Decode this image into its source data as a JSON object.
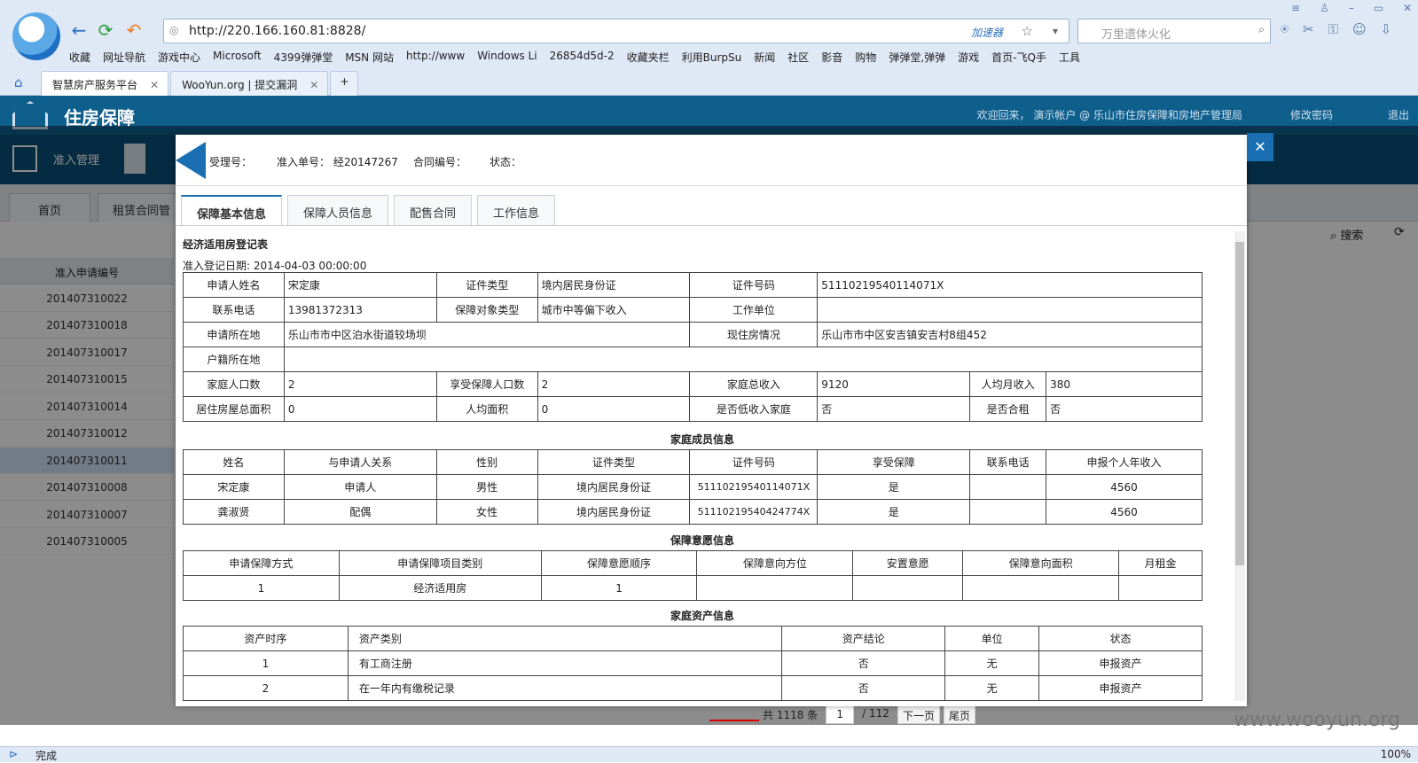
{
  "browser": {
    "url": "http://220.166.160.81:8828/",
    "accelerator": "加速器",
    "search_placeholder": "万里遗体火化",
    "bookmarks": [
      "收藏",
      "网址导航",
      "游戏中心",
      "Microsoft",
      "4399弹弹堂",
      "MSN 网站",
      "http://www",
      "Windows Li",
      "26854d5d-2",
      "收藏夹栏",
      "利用BurpSu",
      "新闻",
      "社区",
      "影音",
      "购物",
      "弹弹堂,弹弹",
      "游戏",
      "首页-飞Q手",
      "工具"
    ],
    "tabs": [
      {
        "label": "智慧房产服务平台"
      },
      {
        "label": "WooYun.org | 提交漏洞"
      }
    ],
    "status": "完成",
    "zoom": "100%"
  },
  "app": {
    "title": "住房保障",
    "welcome": "欢迎回来， 演示帐户 @ 乐山市住房保障和房地产管理局",
    "change_pw": "修改密码",
    "logout": "退出",
    "nav": [
      "准入管理"
    ],
    "subtabs": [
      "首页",
      "租赁合同管"
    ],
    "search": "搜索",
    "list_header": "准入申请编号",
    "list_rows": [
      "201407310022",
      "201407310018",
      "201407310017",
      "201407310015",
      "201407310014",
      "201407310012",
      "201407310011",
      "201407310008",
      "201407310007",
      "201407310005"
    ],
    "pager": {
      "total": "共 1118 条",
      "page": "1",
      "pages": "/ 112",
      "next": "下一页",
      "last": "尾页"
    },
    "watermark": "www.wooyun.org"
  },
  "modal": {
    "f1": "受理号：",
    "f2": "准入单号：  经20147267",
    "f3": "合同编号：",
    "f4": "状态：",
    "tabs": [
      "保障基本信息",
      "保障人员信息",
      "配售合同",
      "工作信息"
    ],
    "form_title": "经济适用房登记表",
    "reg_date_label": "准入登记日期:",
    "reg_date": "2014-04-03 00:00:00",
    "basic": [
      [
        "申请人姓名",
        "宋定康",
        "证件类型",
        "境内居民身份证",
        "证件号码",
        "51110219540114071X"
      ],
      [
        "联系电话",
        "13981372313",
        "保障对象类型",
        "城市中等偏下收入",
        "工作单位",
        ""
      ],
      [
        "申请所在地",
        "乐山市市中区泊水街道较场坝",
        "现住房情况",
        "乐山市市中区安吉镇安吉村8组452"
      ],
      [
        "户籍所在地",
        ""
      ],
      [
        "家庭人口数",
        "2",
        "享受保障人口数",
        "2",
        "家庭总收入",
        "9120",
        "人均月收入",
        "380"
      ],
      [
        "居住房屋总面积",
        "0",
        "人均面积",
        "0",
        "是否低收入家庭",
        "否",
        "是否合租",
        "否"
      ]
    ],
    "family_title": "家庭成员信息",
    "family_head": [
      "姓名",
      "与申请人关系",
      "性别",
      "证件类型",
      "证件号码",
      "享受保障",
      "联系电话",
      "申报个人年收入"
    ],
    "family_rows": [
      [
        "宋定康",
        "申请人",
        "男性",
        "境内居民身份证",
        "51110219540114071X",
        "是",
        "",
        "4560"
      ],
      [
        "龚淑贤",
        "配偶",
        "女性",
        "境内居民身份证",
        "51110219540424774X",
        "是",
        "",
        "4560"
      ]
    ],
    "intent_title": "保障意愿信息",
    "intent_head": [
      "申请保障方式",
      "申请保障项目类别",
      "保障意愿顺序",
      "保障意向方位",
      "安置意愿",
      "保障意向面积",
      "月租金"
    ],
    "intent_rows": [
      [
        "1",
        "经济适用房",
        "1",
        "",
        "",
        "",
        ""
      ]
    ],
    "asset_title": "家庭资产信息",
    "asset_head": [
      "资产时序",
      "资产类别",
      "资产结论",
      "单位",
      "状态"
    ],
    "asset_rows": [
      [
        "1",
        "有工商注册",
        "否",
        "无",
        "申报资产"
      ],
      [
        "2",
        "在一年内有缴税记录",
        "否",
        "无",
        "申报资产"
      ]
    ]
  }
}
